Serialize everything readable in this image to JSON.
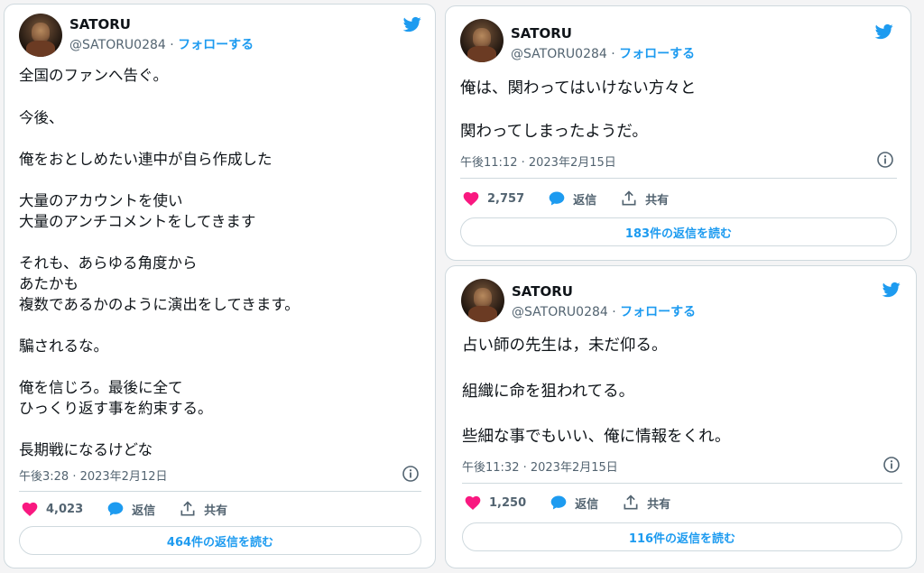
{
  "colors": {
    "accent": "#1d9bf0",
    "heart": "#f91880",
    "muted": "#536471",
    "text": "#0f1419"
  },
  "icons": {
    "brand": "twitter-bird-icon",
    "like": "heart-icon",
    "reply": "speech-bubble-icon",
    "share": "share-icon",
    "info": "info-icon"
  },
  "tweets": [
    {
      "name": "SATORU",
      "handle": "@SATORU0284",
      "separator": "·",
      "follow": "フォローする",
      "lines": [
        "全国のファンへ告ぐ。",
        "今後、",
        "俺をおとしめたい連中が自ら作成した",
        "大量のアカウントを使い",
        "大量のアンチコメントをしてきます",
        "それも、あらゆる角度から",
        "あたかも",
        "複数であるかのように演出をしてきます。",
        "騙されるな。",
        "俺を信じろ。最後に全て",
        "ひっくり返す事を約束する。",
        "長期戦になるけどな"
      ],
      "time": "午後3:28 · 2023年2月12日",
      "likes": "4,023",
      "reply_label": "返信",
      "share_label": "共有",
      "read_replies": "464件の返信を読む"
    },
    {
      "name": "SATORU",
      "handle": "@SATORU0284",
      "separator": "·",
      "follow": "フォローする",
      "lines": [
        "俺は、関わってはいけない方々と",
        "関わってしまったようだ。"
      ],
      "time": "午後11:12 · 2023年2月15日",
      "likes": "2,757",
      "reply_label": "返信",
      "share_label": "共有",
      "read_replies": "183件の返信を読む"
    },
    {
      "name": "SATORU",
      "handle": "@SATORU0284",
      "separator": "·",
      "follow": "フォローする",
      "lines": [
        "占い師の先生は，未だ仰る。",
        "組織に命を狙われてる。",
        "些細な事でもいい、俺に情報をくれ。"
      ],
      "time": "午後11:32 · 2023年2月15日",
      "likes": "1,250",
      "reply_label": "返信",
      "share_label": "共有",
      "read_replies": "116件の返信を読む"
    }
  ]
}
